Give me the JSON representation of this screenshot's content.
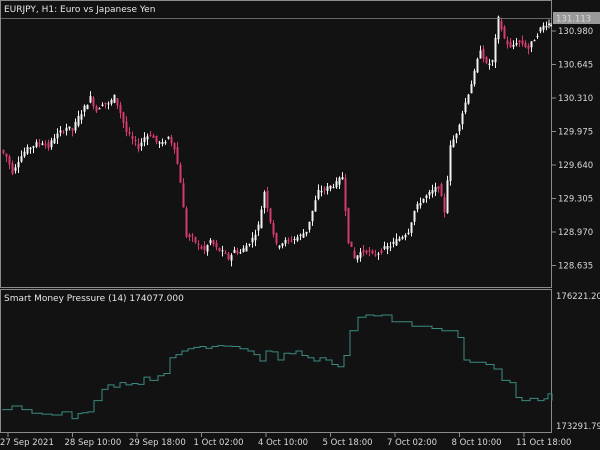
{
  "colors": {
    "background": "#121212",
    "frame": "#8a8a8a",
    "text": "#e6e6e6",
    "candle": "#f2f2f2",
    "candle_bear": "#d63a6e",
    "indicator_line": "#3a8a82",
    "price_label_bg": "#9a9a9a",
    "price_label_text": "#000000"
  },
  "price_panel": {
    "title": "EURJPY, H1:  Euro vs Japanese Yen",
    "current_price": "131.113",
    "ticks": [
      "130.980",
      "130.645",
      "130.310",
      "129.975",
      "129.640",
      "129.305",
      "128.970",
      "128.635"
    ]
  },
  "indicator_panel": {
    "title": "Smart Money Pressure (14) 174077.000",
    "top_value": "176221.205",
    "bottom_value": "173291.795"
  },
  "time_axis": [
    "27 Sep 2021",
    "28 Sep 10:00",
    "29 Sep 18:00",
    "1 Oct 02:00",
    "4 Oct 10:00",
    "5 Oct 18:00",
    "7 Oct 02:00",
    "8 Oct 10:00",
    "11 Oct 18:00"
  ],
  "chart_data": [
    {
      "type": "line",
      "name": "EURJPY H1 close",
      "ylim": [
        128.48,
        131.26
      ],
      "x": [
        0,
        6,
        12,
        18,
        24,
        30,
        36,
        42,
        48,
        54,
        60,
        66,
        72,
        78,
        84,
        90,
        96,
        102,
        108,
        114,
        120,
        126,
        132,
        138,
        144,
        150,
        156,
        162,
        168,
        174,
        180,
        186,
        192,
        198,
        204,
        210,
        216,
        222,
        228,
        234,
        240,
        246,
        252,
        258,
        264,
        270,
        276,
        282,
        288,
        294,
        300,
        306,
        312,
        318,
        324,
        330,
        336,
        342,
        348,
        354,
        360,
        366,
        372,
        378,
        384,
        390,
        396,
        402,
        408,
        414,
        420,
        426,
        432,
        438,
        444,
        450,
        456,
        462,
        468,
        474,
        480,
        486,
        492,
        498,
        504,
        510,
        516,
        522,
        528,
        534,
        540,
        546,
        550
      ],
      "y": [
        129.82,
        129.75,
        129.6,
        129.72,
        129.8,
        129.85,
        129.88,
        129.9,
        129.85,
        129.95,
        130.0,
        130.05,
        130.02,
        130.15,
        130.25,
        130.35,
        130.22,
        130.3,
        130.28,
        130.36,
        130.2,
        130.0,
        129.92,
        129.85,
        129.95,
        129.98,
        129.9,
        129.88,
        129.95,
        129.85,
        129.5,
        128.95,
        128.92,
        128.85,
        128.8,
        128.9,
        128.82,
        128.78,
        128.72,
        128.8,
        128.78,
        128.85,
        128.92,
        129.05,
        129.4,
        129.1,
        128.85,
        128.88,
        128.9,
        128.92,
        128.95,
        129.0,
        129.2,
        129.4,
        129.42,
        129.45,
        129.48,
        129.55,
        128.9,
        128.72,
        128.78,
        128.8,
        128.75,
        128.78,
        128.82,
        128.85,
        128.9,
        128.95,
        129.0,
        129.2,
        129.3,
        129.35,
        129.4,
        129.45,
        129.2,
        129.85,
        130.0,
        130.2,
        130.4,
        130.6,
        130.85,
        130.68,
        130.72,
        131.15,
        130.95,
        130.85,
        130.92,
        130.9,
        130.85,
        130.95,
        131.05,
        131.1,
        131.1
      ]
    },
    {
      "type": "line",
      "name": "Smart Money Pressure (14)",
      "ylim": [
        173291.795,
        176221.205
      ],
      "x": [
        0,
        10,
        20,
        30,
        40,
        50,
        60,
        70,
        76,
        80,
        86,
        92,
        100,
        106,
        112,
        118,
        124,
        130,
        136,
        142,
        148,
        156,
        162,
        168,
        174,
        180,
        186,
        192,
        198,
        204,
        210,
        216,
        222,
        230,
        238,
        246,
        252,
        258,
        264,
        270,
        276,
        282,
        288,
        294,
        300,
        306,
        312,
        318,
        324,
        330,
        336,
        342,
        348,
        356,
        364,
        372,
        380,
        390,
        400,
        410,
        420,
        430,
        440,
        448,
        456,
        462,
        468,
        476,
        484,
        492,
        500,
        508,
        514,
        520,
        528,
        536,
        542,
        546,
        550
      ],
      "y": [
        173700,
        173780,
        173700,
        173620,
        173600,
        173580,
        173650,
        173500,
        173610,
        173630,
        173650,
        173900,
        174150,
        174250,
        174200,
        174300,
        174250,
        174280,
        174260,
        174420,
        174350,
        174450,
        174500,
        174850,
        174920,
        175000,
        175050,
        175080,
        175100,
        175060,
        175100,
        175120,
        175110,
        175100,
        175050,
        175000,
        174920,
        174780,
        175000,
        174980,
        174800,
        174950,
        174940,
        175000,
        174900,
        174850,
        174780,
        174850,
        174800,
        174700,
        174650,
        174900,
        175450,
        175750,
        175800,
        175780,
        175800,
        175650,
        175650,
        175550,
        175550,
        175500,
        175450,
        175450,
        175300,
        174800,
        174750,
        174750,
        174700,
        174600,
        174350,
        174300,
        173970,
        173900,
        173950,
        173900,
        173940,
        174050,
        173900
      ]
    }
  ]
}
